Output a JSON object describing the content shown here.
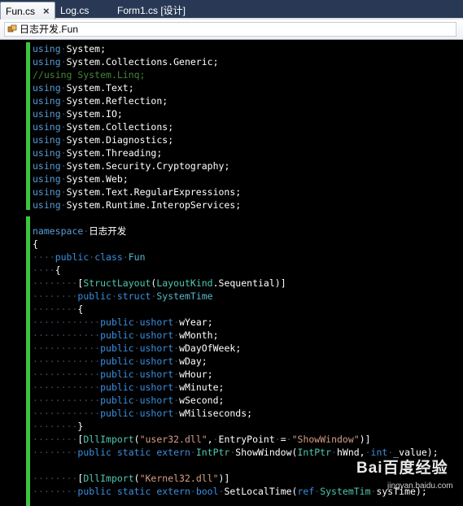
{
  "tabs": [
    {
      "label": "Fun.cs",
      "active": true,
      "close": "×"
    },
    {
      "label": "Log.cs",
      "active": false
    },
    {
      "label": "Form1.cs [设计]",
      "active": false
    }
  ],
  "navbar": {
    "type_selector": "日志开发.Fun",
    "icon": "class-icon"
  },
  "colors": {
    "keyword": "#569cd6",
    "type": "#4ec9b0",
    "string": "#d69d85",
    "comment": "#57a64a",
    "change_bar": "#3ec63e",
    "background": "#000000"
  },
  "code": {
    "using_keyword": "using",
    "usings": [
      "System",
      "System.Collections.Generic",
      "System.Text",
      "System.Reflection",
      "System.IO",
      "System.Collections",
      "System.Diagnostics",
      "System.Threading",
      "System.Security.Cryptography",
      "System.Web",
      "System.Text.RegularExpressions",
      "System.Runtime.InteropServices"
    ],
    "commented_using": "//using System.Linq;",
    "namespace_keyword": "namespace",
    "namespace_name": "日志开发",
    "class_decl": {
      "modifier": "public",
      "keyword": "class",
      "name": "Fun"
    },
    "struct_attribute": {
      "name": "StructLayout",
      "arg_type": "LayoutKind",
      "arg_value": ".Sequential"
    },
    "struct_decl": {
      "modifier": "public",
      "keyword": "struct",
      "name": "SystemTime"
    },
    "fields": [
      {
        "modifier": "public",
        "type": "ushort",
        "name": "wYear"
      },
      {
        "modifier": "public",
        "type": "ushort",
        "name": "wMonth"
      },
      {
        "modifier": "public",
        "type": "ushort",
        "name": "wDayOfWeek"
      },
      {
        "modifier": "public",
        "type": "ushort",
        "name": "wDay"
      },
      {
        "modifier": "public",
        "type": "ushort",
        "name": "wHour"
      },
      {
        "modifier": "public",
        "type": "ushort",
        "name": "wMinute"
      },
      {
        "modifier": "public",
        "type": "ushort",
        "name": "wSecond"
      },
      {
        "modifier": "public",
        "type": "ushort",
        "name": "wMiliseconds"
      }
    ],
    "dllimport1": {
      "name": "DllImport",
      "dll": "\"user32.dll\"",
      "entry_label": "EntryPoint",
      "entry_value": "\"ShowWindow\""
    },
    "extern1": {
      "modifiers": "public static extern",
      "ret": "IntPtr",
      "name": "ShowWindow",
      "p1_type": "IntPtr",
      "p1_name": "hWnd,",
      "p2_type": "int",
      "p2_name": "_value);"
    },
    "dllimport2": {
      "name": "DllImport",
      "dll": "\"Kernel32.dll\""
    },
    "extern2": {
      "modifiers": "public static extern",
      "ret": "bool",
      "name": "SetLocalTime",
      "ref": "ref",
      "p1_type": "SystemTim",
      "p1_name": "sysTime);"
    }
  },
  "watermark": {
    "logo": "Bai百度经验",
    "sub": "jingyan.baidu.com"
  }
}
